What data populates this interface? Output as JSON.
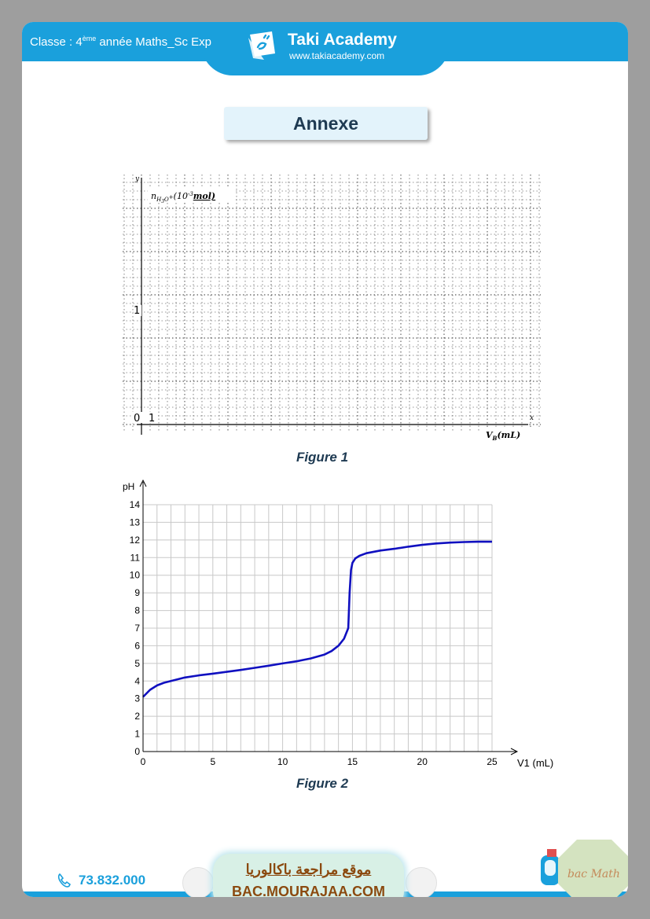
{
  "header": {
    "classe_prefix": "Classe : 4",
    "classe_sup": "ème",
    "classe_suffix": " année Maths_Sc Exp",
    "brand": "Taki Academy",
    "url": "www.takiacademy.com",
    "color": "#1aa0dc"
  },
  "title": "Annexe",
  "figure1": {
    "caption": "Figure 1",
    "ylabel_main": "n",
    "ylabel_sub": "H",
    "ylabel_sub2": "3",
    "ylabel_sub3": "O",
    "ylabel_plus": "+",
    "ylabel_rest": "(10",
    "ylabel_exp": "-3",
    "ylabel_unit": "mol)",
    "xlabel_main": "V",
    "xlabel_sub": "B",
    "xlabel_unit": "(mL)",
    "axis_y": "y",
    "axis_x": "x",
    "origin": "0",
    "tick_x": "1",
    "tick_y": "1"
  },
  "chart_data": {
    "type": "line",
    "title": "Figure 2",
    "xlabel": "V1 (mL)",
    "ylabel": "pH",
    "xlim": [
      0,
      25
    ],
    "ylim": [
      0,
      14
    ],
    "xticks": [
      "0",
      "5",
      "10",
      "15",
      "20",
      "25"
    ],
    "yticks": [
      "0",
      "1",
      "2",
      "3",
      "4",
      "5",
      "6",
      "7",
      "8",
      "9",
      "10",
      "11",
      "12",
      "13",
      "14"
    ],
    "grid": true,
    "series": [
      {
        "color": "#1010c0",
        "x": [
          0,
          0.5,
          1,
          1.5,
          2,
          3,
          4,
          5,
          6,
          7,
          8,
          9,
          10,
          11,
          12,
          13,
          13.5,
          14,
          14.4,
          14.7,
          14.8,
          14.9,
          15,
          15.2,
          15.5,
          16,
          17,
          18,
          19,
          20,
          21,
          22,
          23,
          24,
          25
        ],
        "y": [
          3.1,
          3.5,
          3.75,
          3.9,
          4.0,
          4.2,
          4.32,
          4.42,
          4.52,
          4.63,
          4.75,
          4.87,
          5.0,
          5.12,
          5.28,
          5.5,
          5.7,
          6.0,
          6.4,
          7.0,
          9.0,
          10.3,
          10.7,
          10.95,
          11.1,
          11.25,
          11.4,
          11.5,
          11.62,
          11.72,
          11.8,
          11.85,
          11.88,
          11.9,
          11.9
        ]
      }
    ]
  },
  "footer": {
    "phone": "73.832.000",
    "mouraja_ar": "موقع مراجعة  باكالوريا",
    "mouraja_url": "BAC.MOURAJAA.COM",
    "bacmath": "bac Math"
  }
}
